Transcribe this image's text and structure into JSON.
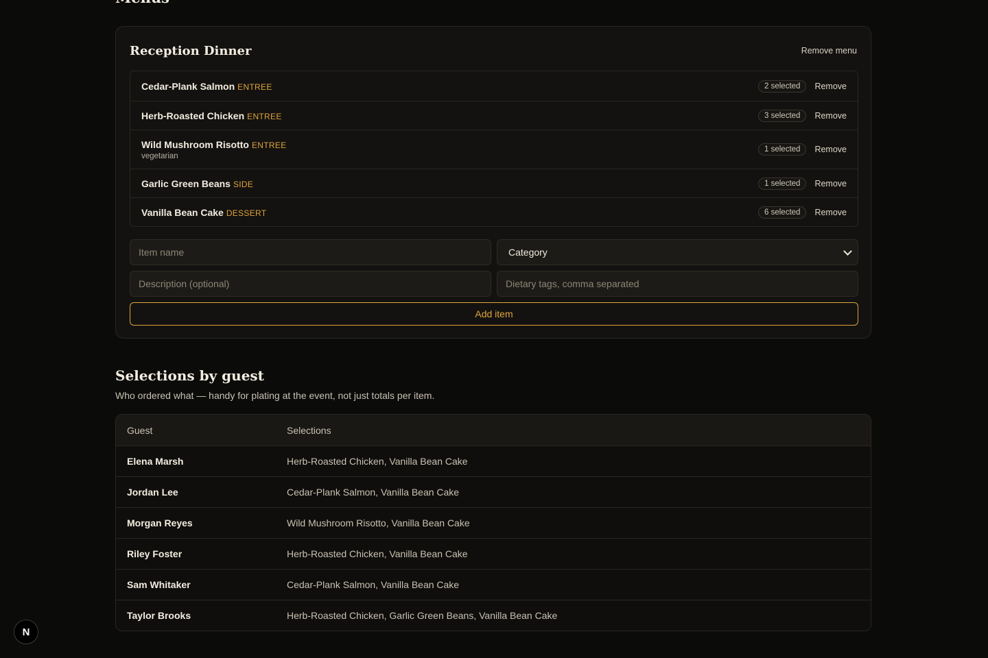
{
  "top_section": {
    "title": "Menus"
  },
  "menu": {
    "title": "Reception Dinner",
    "remove_menu_label": "Remove menu",
    "remove_label": "Remove",
    "items": [
      {
        "name": "Cedar-Plank Salmon",
        "category": "ENTREE",
        "description": "",
        "selected": "2 selected"
      },
      {
        "name": "Herb-Roasted Chicken",
        "category": "ENTREE",
        "description": "",
        "selected": "3 selected"
      },
      {
        "name": "Wild Mushroom Risotto",
        "category": "ENTREE",
        "description": "vegetarian",
        "selected": "1 selected"
      },
      {
        "name": "Garlic Green Beans",
        "category": "SIDE",
        "description": "",
        "selected": "1 selected"
      },
      {
        "name": "Vanilla Bean Cake",
        "category": "DESSERT",
        "description": "",
        "selected": "6 selected"
      }
    ],
    "form": {
      "item_name_placeholder": "Item name",
      "category_value": "Category",
      "description_placeholder": "Description (optional)",
      "dietary_placeholder": "Dietary tags, comma separated",
      "add_item_label": "Add item"
    }
  },
  "selections": {
    "title": "Selections by guest",
    "subtitle": "Who ordered what — handy for plating at the event, not just totals per item.",
    "columns": [
      "Guest",
      "Selections"
    ],
    "rows": [
      {
        "guest": "Elena Marsh",
        "selections": "Herb-Roasted Chicken, Vanilla Bean Cake"
      },
      {
        "guest": "Jordan Lee",
        "selections": "Cedar-Plank Salmon, Vanilla Bean Cake"
      },
      {
        "guest": "Morgan Reyes",
        "selections": "Wild Mushroom Risotto, Vanilla Bean Cake"
      },
      {
        "guest": "Riley Foster",
        "selections": "Herb-Roasted Chicken, Vanilla Bean Cake"
      },
      {
        "guest": "Sam Whitaker",
        "selections": "Cedar-Plank Salmon, Vanilla Bean Cake"
      },
      {
        "guest": "Taylor Brooks",
        "selections": "Herb-Roasted Chicken, Garlic Green Beans, Vanilla Bean Cake"
      }
    ]
  },
  "dev_badge": {
    "letter": "N"
  },
  "colors": {
    "accent": "#e0a43a",
    "background": "#0b0b0a",
    "card": "#131210",
    "border": "#2a2722"
  }
}
